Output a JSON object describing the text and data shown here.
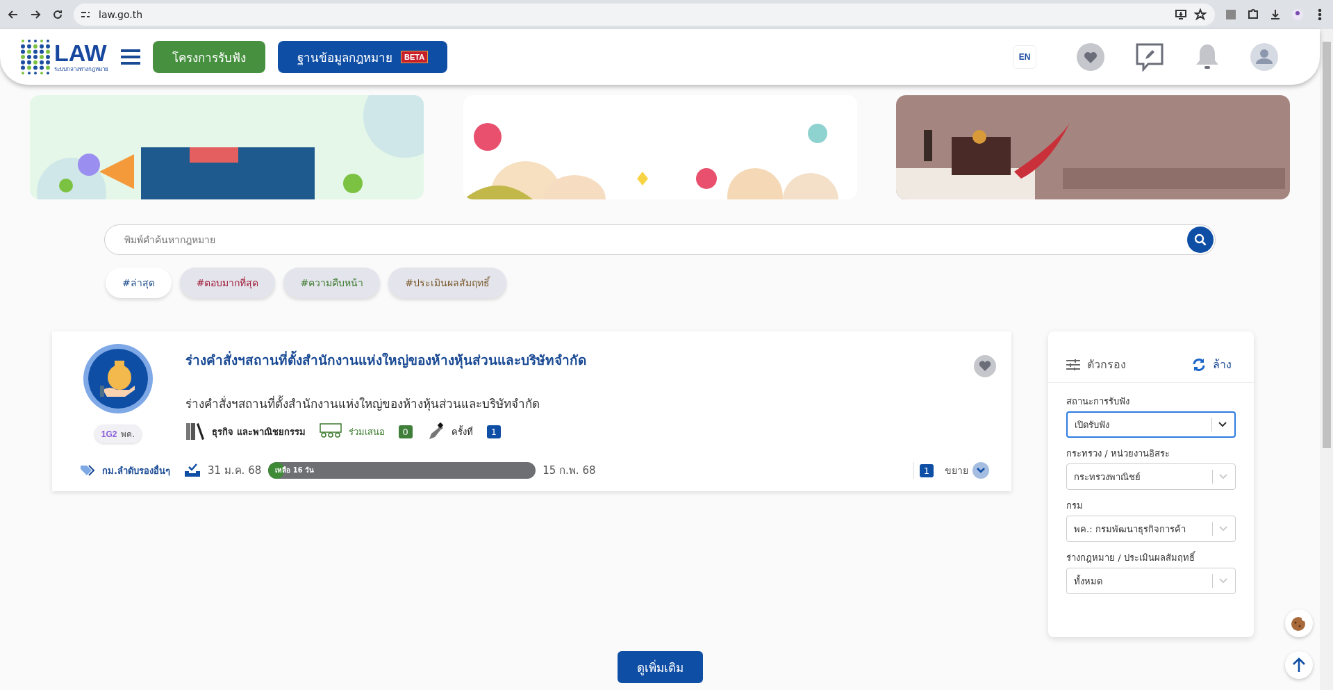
{
  "browser": {
    "url": "law.go.th"
  },
  "header": {
    "logo": {
      "title": "LAW",
      "subtitle": "ระบบกลางทางกฎหมาย"
    },
    "nav_buttons": [
      {
        "label": "โครงการรับฟัง",
        "kind": "green"
      },
      {
        "label": "ฐานข้อมูลกฎหมาย",
        "kind": "blue",
        "badge": "BETA"
      }
    ],
    "language": "EN"
  },
  "search": {
    "placeholder": "พิมพ์คำค้นหากฎหมาย"
  },
  "tags": [
    {
      "label": "#ล่าสุด",
      "selected": true,
      "color": "#1f4e8c"
    },
    {
      "label": "#ตอบมากที่สุด",
      "selected": false,
      "color": "#a01d3a"
    },
    {
      "label": "#ความคืบหน้า",
      "selected": false,
      "color": "#3c7a2e"
    },
    {
      "label": "#ประเมินผลสัมฤทธิ์",
      "selected": false,
      "color": "#7a5a2e"
    }
  ],
  "card": {
    "title": "ร่างคำสั่งฯสถานที่ตั้งสำนักงานแห่งใหญ่ของห้างหุ้นส่วนและบริษัทจำกัด",
    "description": "ร่างคำสั่งฯสถานที่ตั้งสำนักงานแห่งใหญ่ของห้างหุ้นส่วนและบริษัทจำกัด",
    "agency_badge": {
      "logo": "1G2",
      "label": "พค."
    },
    "category": "ธุรกิจ และพาณิชยกรรม",
    "participants": {
      "label": "ร่วมเสนอ",
      "count": "0"
    },
    "round": {
      "label": "ครั้งที่",
      "count": "1"
    },
    "tag": "กม.ลำดับรองอื่นๆ",
    "start_date": "31 ม.ค. 68",
    "progress": {
      "label": "เหลือ 16 วัน",
      "level": 0.06
    },
    "end_date": "15 ก.พ. 68",
    "expand": {
      "count": "1",
      "label": "ขยาย"
    }
  },
  "filter": {
    "title": "ตัวกรอง",
    "clear": "ล้าง",
    "fields": [
      {
        "label": "สถานะการรับฟัง",
        "value": "เปิดรับฟัง",
        "focused": true
      },
      {
        "label": "กระทรวง / หน่วยงานอิสระ",
        "value": "กระทรวงพาณิชย์",
        "focused": false
      },
      {
        "label": "กรม",
        "value": "พค.: กรมพัฒนาธุรกิจการค้า",
        "focused": false
      },
      {
        "label": "ร่างกฎหมาย / ประเมินผลสัมฤทธิ์",
        "value": "ทั้งหมด",
        "focused": false
      }
    ]
  },
  "load_more": "ดูเพิ่มเติม"
}
